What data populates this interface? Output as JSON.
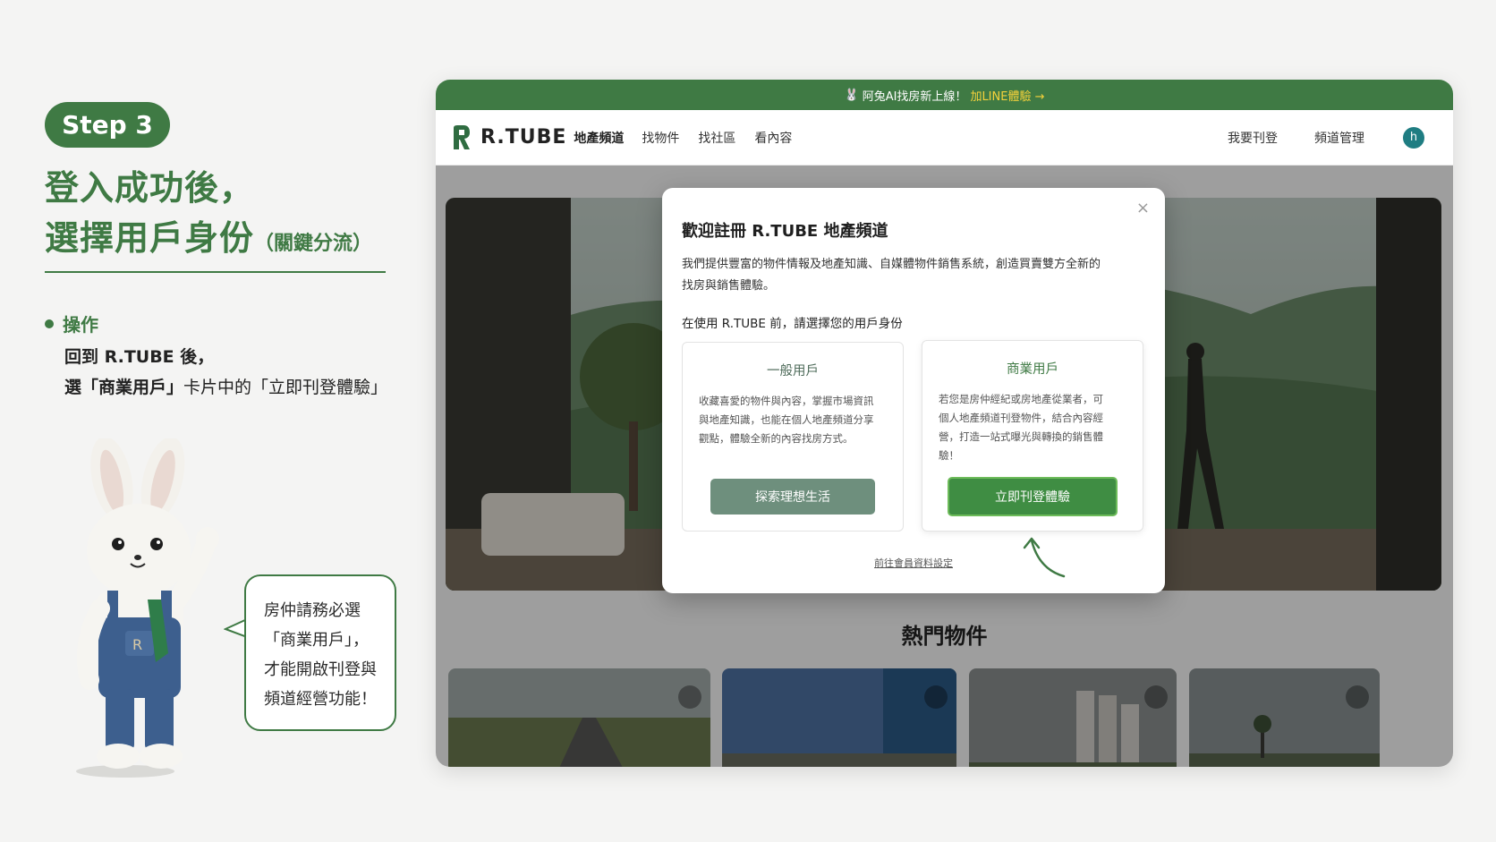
{
  "tutorial": {
    "step": "Step 3",
    "headline_line1": "登入成功後，",
    "headline_line2": "選擇用戶身份",
    "headline_note": "（關鍵分流）",
    "op_label": "操作",
    "op_line1": "回到 R.TUBE 後，",
    "op_line2_pre": "選",
    "op_line2_bold": "「商業用戶」",
    "op_line2_post": "卡片中的「立即刊登體驗」",
    "bubble_line1": "房仲請務必選",
    "bubble_line2": "「商業用戶」，",
    "bubble_line3": "才能開啟刊登與",
    "bubble_line4": "頻道經營功能！"
  },
  "site": {
    "announce_text": "阿兔AI找房新上線！",
    "announce_cta": "加LINE體驗 →",
    "logo_text": "R.TUBE",
    "logo_sub": "地產頻道",
    "nav": [
      "找物件",
      "找社區",
      "看內容"
    ],
    "nav_right": [
      "我要刊登",
      "頻道管理"
    ],
    "avatar_letter": "h",
    "hot_title": "熱門物件"
  },
  "modal": {
    "close": "×",
    "title": "歡迎註冊 R.TUBE 地產頻道",
    "desc_line1": "我們提供豐富的物件情報及地產知識、自媒體物件銷售系統，創造買賣雙方全新的",
    "desc_line2": "找房與銷售體驗。",
    "prompt": "在使用 R.TUBE 前，請選擇您的用戶身份",
    "general": {
      "title": "一般用戶",
      "desc_line1": "收藏喜愛的物件與內容，掌握市場資訊",
      "desc_line2": "與地產知識，也能在個人地產頻道分享",
      "desc_line3": "觀點，體驗全新的內容找房方式。",
      "button": "探索理想生活"
    },
    "business": {
      "title": "商業用戶",
      "desc_line1": "若您是房仲經紀或房地產從業者，可",
      "desc_line2": "個人地產頻道刊登物件，結合內容經",
      "desc_line3": "營，打造一站式曝光與轉換的銷售體",
      "desc_line4": "驗！",
      "button": "立即刊登體驗"
    },
    "settings_link": "前往會員資料設定"
  },
  "colors": {
    "brand_green": "#3f7a44",
    "cta_yellow": "#f4d13b",
    "avatar_teal": "#1f7d82"
  }
}
